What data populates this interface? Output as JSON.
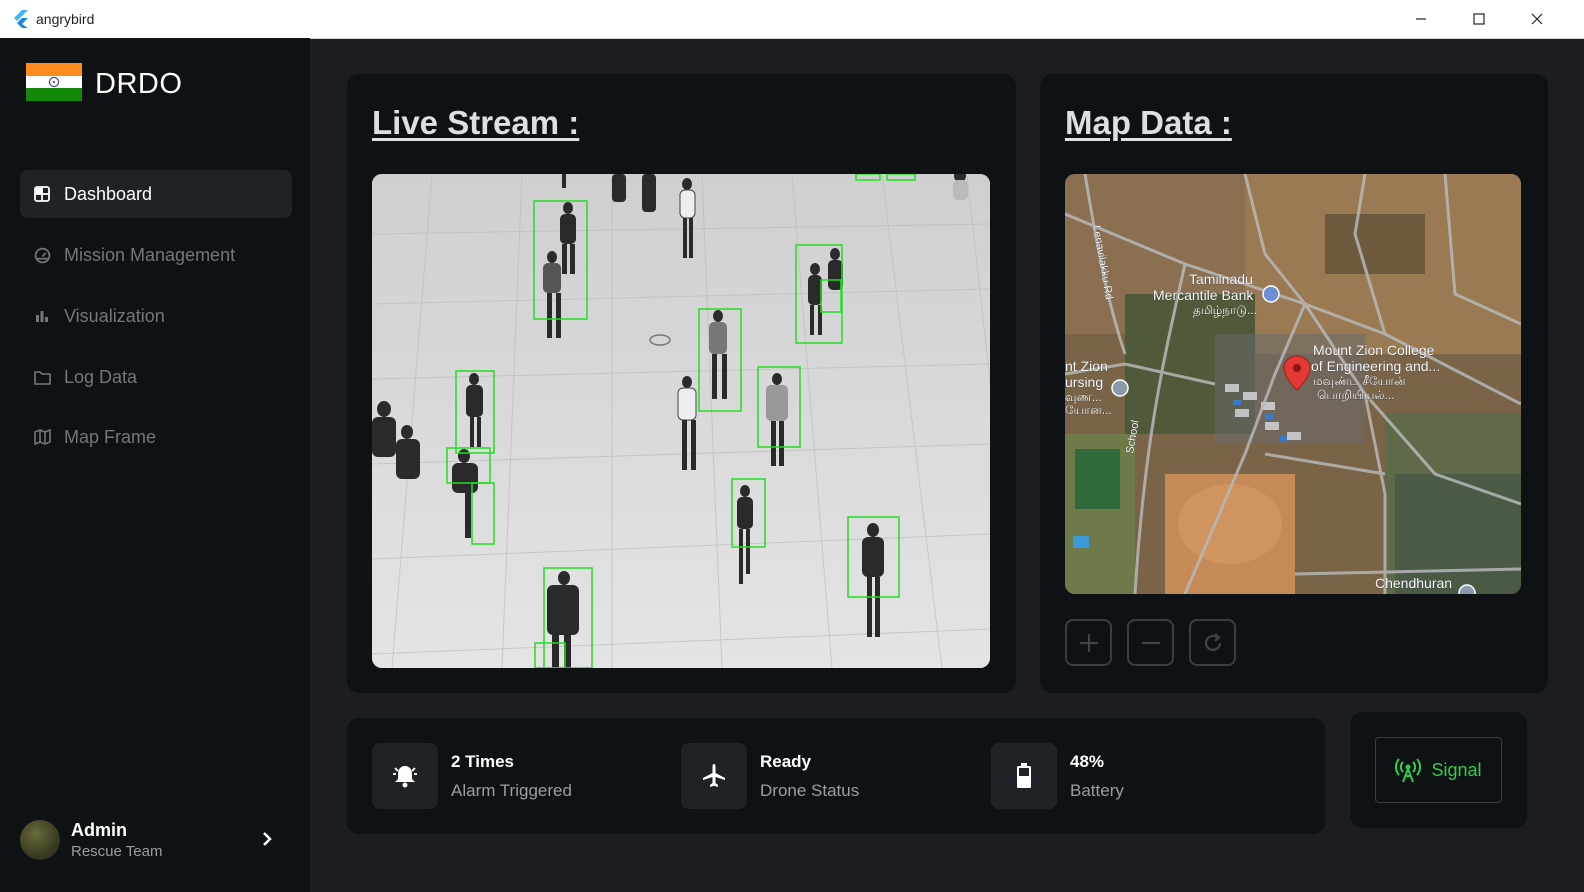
{
  "window": {
    "title": "angrybird"
  },
  "brand": {
    "name": "DRDO"
  },
  "nav": {
    "items": [
      {
        "label": "Dashboard",
        "icon": "dashboard-icon",
        "active": true
      },
      {
        "label": "Mission Management",
        "icon": "gauge-icon",
        "active": false
      },
      {
        "label": "Visualization",
        "icon": "bar-chart-icon",
        "active": false
      },
      {
        "label": "Log Data",
        "icon": "folder-icon",
        "active": false
      },
      {
        "label": "Map Frame",
        "icon": "map-icon",
        "active": false
      }
    ]
  },
  "user": {
    "name": "Admin",
    "role": "Rescue Team"
  },
  "live_stream": {
    "title": "Live Stream :"
  },
  "map_data": {
    "title": "Map Data :",
    "labels": [
      "Lenavilakku Rd",
      "Tamilnadu",
      "Mercantile Bank",
      "தமிழ்நாடு...",
      "Mount Zion College",
      "of Engineering and...",
      "மவுண்ட் சீயோன்",
      "பொறியியல்...",
      "nt Zion",
      "ursing",
      "வுண...",
      "யோன...",
      "School",
      "Chendhuran"
    ],
    "controls": [
      "zoom-in",
      "zoom-out",
      "refresh"
    ]
  },
  "status": {
    "alarm": {
      "value": "2 Times",
      "label": "Alarm Triggered"
    },
    "drone": {
      "value": "Ready",
      "label": "Drone Status"
    },
    "battery": {
      "value": "48%",
      "label": "Battery"
    }
  },
  "signal": {
    "label": "Signal"
  },
  "colors": {
    "background": "#1b1d22",
    "panel": "#0f1215",
    "accent_green": "#2dcf44",
    "detection_box": "#22dd22"
  }
}
